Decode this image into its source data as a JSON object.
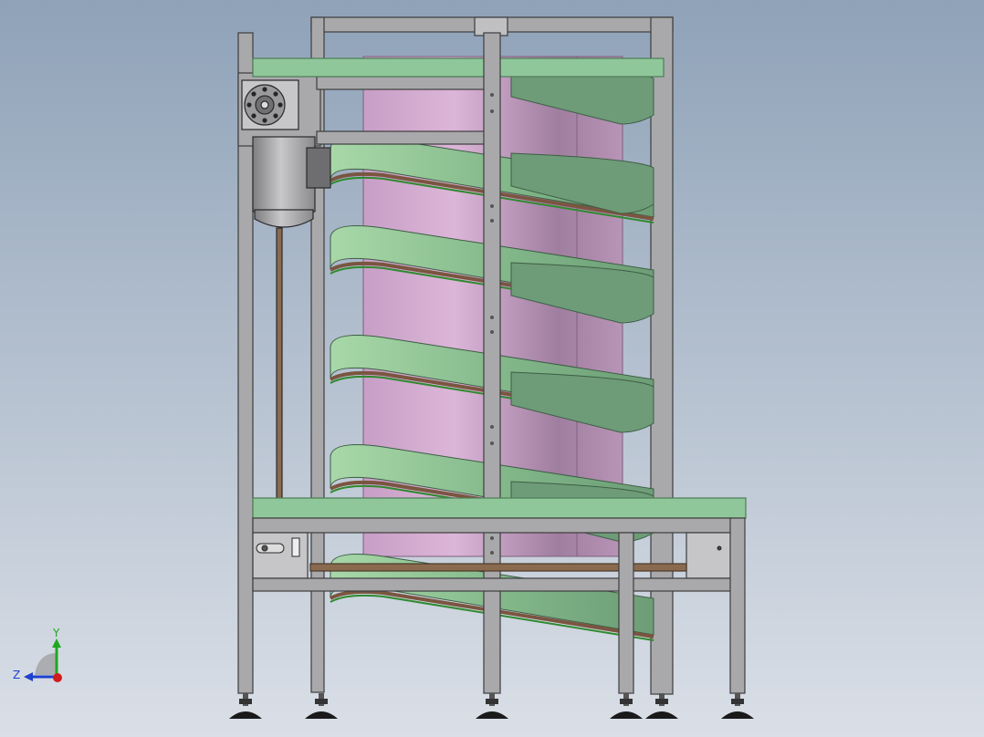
{
  "app": {
    "view": "CAD 3D viewport"
  },
  "colors": {
    "background_top": "#8fa2b8",
    "background_bottom": "#d8dde6",
    "frame_steel": "#a9a9ab",
    "frame_edge": "#3c3c3e",
    "belt_green": "#8fc79a",
    "belt_green_dark": "#5f9a6c",
    "belt_brown": "#7a5540",
    "drum_pink": "#c9a2c9",
    "drum_pink_dark": "#9c789c",
    "foot_black": "#1a1a1a",
    "axis_x": "#d01c1c",
    "axis_y": "#1fa81f",
    "axis_z": "#1f3fd0"
  },
  "triad": {
    "y_label": "Y",
    "z_label": "Z",
    "icon": "coordinate-triad-icon"
  }
}
